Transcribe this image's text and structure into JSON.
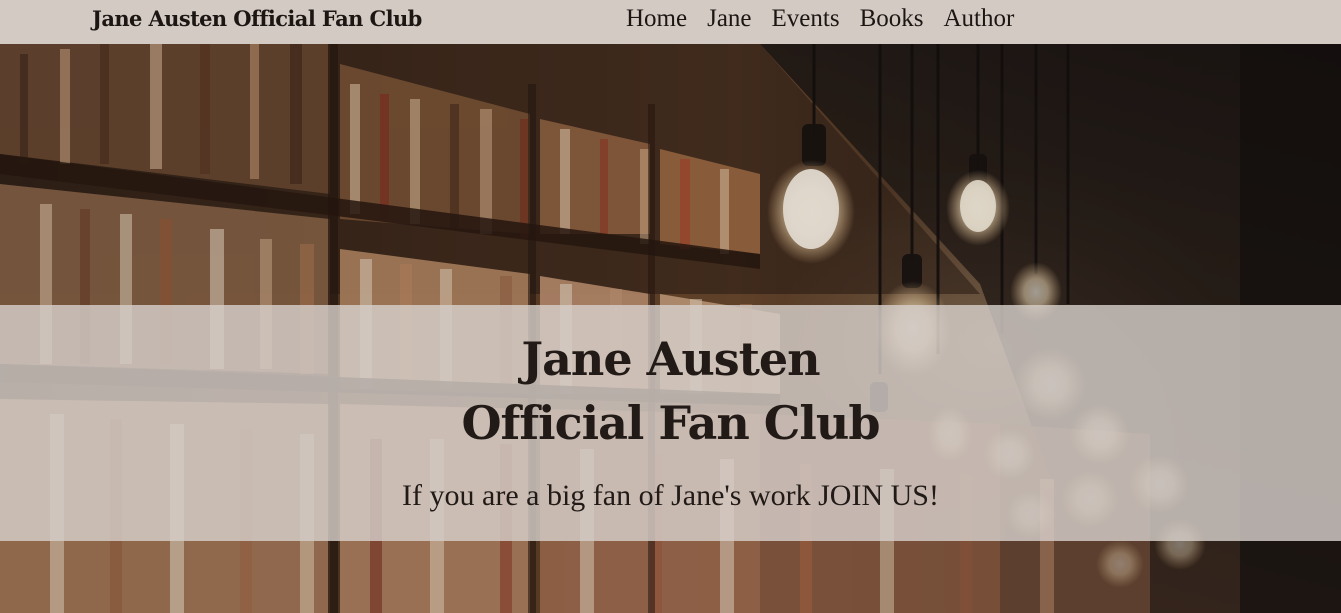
{
  "nav": {
    "brand": "Jane Austen Official Fan Club",
    "links": [
      {
        "label": "Home"
      },
      {
        "label": "Jane"
      },
      {
        "label": "Events"
      },
      {
        "label": "Books"
      },
      {
        "label": "Author"
      }
    ]
  },
  "hero": {
    "background": "library-bookshelves-with-hanging-light-bulbs",
    "title_line1": "Jane Austen",
    "title_line2": "Official Fan Club",
    "subtitle": "If you are a big fan of Jane's work JOIN US!"
  },
  "colors": {
    "navbar_bg": "#d4cac4",
    "banner_bg": "#d6cec9",
    "text": "#211a16"
  }
}
